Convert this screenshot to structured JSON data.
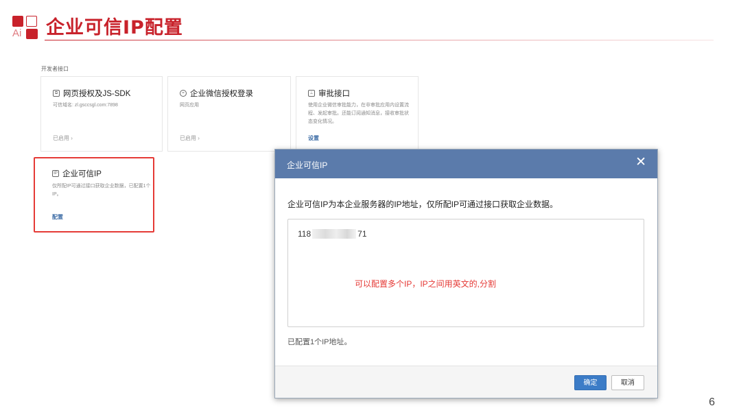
{
  "slide": {
    "logo_text": "Ai",
    "title": "企业可信IP配置",
    "page_number": "6",
    "brand_color": "#c8222b"
  },
  "section": {
    "label": "开发者接口"
  },
  "cards": [
    {
      "icon": "web-copy-icon",
      "title": "网页授权及JS-SDK",
      "desc": "可信域名: zl.gsccsgl.com:7898",
      "footer": "已启用 ›"
    },
    {
      "icon": "chat-icon",
      "title": "企业微信授权登录",
      "desc": "网页应用",
      "footer": "已启用 ›"
    },
    {
      "icon": "stamp-icon",
      "title": "审批接口",
      "desc": "使用企业微信审批能力，在非审批应用内设置流程、发起审批。还能订阅通知消息，接收审批状态变化情况。",
      "footer": "设置"
    },
    {
      "icon": "ip-icon",
      "title": "企业可信IP",
      "desc": "仅所配IP可通过接口获取企业数据，已配置1个IP。",
      "footer": "配置"
    }
  ],
  "modal": {
    "title": "企业可信IP",
    "close_symbol": "✕",
    "description": "企业可信IP为本企业服务器的IP地址，仅所配IP可通过接口获取企业数据。",
    "ip_prefix": "118",
    "ip_suffix": "71",
    "annotation": "可以配置多个IP，IP之间用英文的,分割",
    "ip_count": "已配置1个IP地址。",
    "confirm_label": "确定",
    "cancel_label": "取消",
    "header_color": "#5b7bab",
    "confirm_color": "#3c7cc7",
    "annotation_color": "#e53935"
  }
}
